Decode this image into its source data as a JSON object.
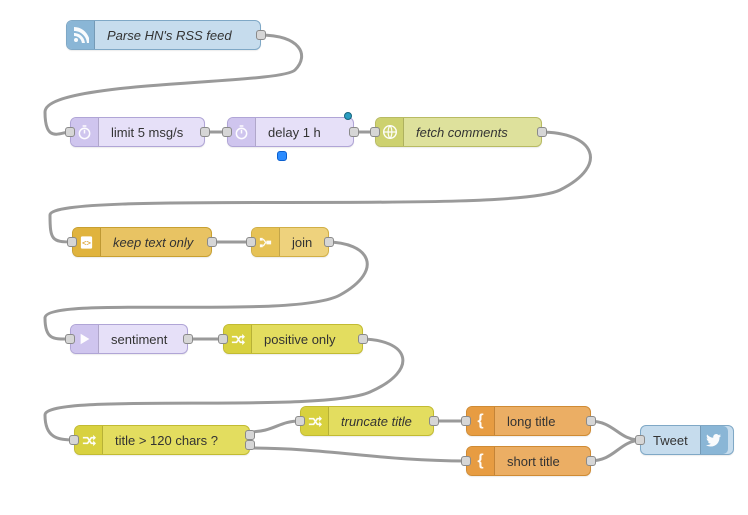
{
  "nodes": {
    "parse_rss": {
      "label": "Parse HN's RSS feed"
    },
    "limit": {
      "label": "limit 5 msg/s"
    },
    "delay": {
      "label": "delay 1 h"
    },
    "fetch": {
      "label": "fetch comments"
    },
    "keep_text": {
      "label": "keep text only"
    },
    "join": {
      "label": "join"
    },
    "sentiment": {
      "label": "sentiment"
    },
    "positive": {
      "label": "positive only"
    },
    "title_check": {
      "label": "title > 120 chars ?"
    },
    "truncate": {
      "label": "truncate title"
    },
    "long_title": {
      "label": "long title"
    },
    "short_title": {
      "label": "short title"
    },
    "tweet": {
      "label": "Tweet"
    }
  },
  "chart_data": {
    "type": "flow-diagram",
    "description": "Node-based flow (Node-RED style) that reads Hacker News RSS, fetches comments, filters by positive sentiment, truncates long titles, and tweets.",
    "nodes": [
      {
        "id": "parse_rss",
        "label": "Parse HN's RSS feed",
        "kind": "rss-in",
        "color": "blue"
      },
      {
        "id": "limit",
        "label": "limit 5 msg/s",
        "kind": "delay/limit",
        "color": "purple"
      },
      {
        "id": "delay",
        "label": "delay 1 h",
        "kind": "delay",
        "color": "purple"
      },
      {
        "id": "fetch",
        "label": "fetch comments",
        "kind": "http-request",
        "color": "olive"
      },
      {
        "id": "keep_text",
        "label": "keep text only",
        "kind": "html/extract",
        "color": "gold"
      },
      {
        "id": "join",
        "label": "join",
        "kind": "join",
        "color": "gold"
      },
      {
        "id": "sentiment",
        "label": "sentiment",
        "kind": "sentiment",
        "color": "purple"
      },
      {
        "id": "positive",
        "label": "positive only",
        "kind": "switch",
        "color": "yellow"
      },
      {
        "id": "title_check",
        "label": "title > 120 chars ?",
        "kind": "switch",
        "color": "yellow"
      },
      {
        "id": "truncate",
        "label": "truncate title",
        "kind": "switch/change",
        "color": "yellow"
      },
      {
        "id": "long_title",
        "label": "long title",
        "kind": "template",
        "color": "orange"
      },
      {
        "id": "short_title",
        "label": "short title",
        "kind": "template",
        "color": "orange"
      },
      {
        "id": "tweet",
        "label": "Tweet",
        "kind": "twitter-out",
        "color": "blue"
      }
    ],
    "edges": [
      [
        "parse_rss",
        "limit"
      ],
      [
        "limit",
        "delay"
      ],
      [
        "delay",
        "fetch"
      ],
      [
        "fetch",
        "keep_text"
      ],
      [
        "keep_text",
        "join"
      ],
      [
        "join",
        "sentiment"
      ],
      [
        "sentiment",
        "positive"
      ],
      [
        "positive",
        "title_check"
      ],
      [
        "title_check",
        "truncate"
      ],
      [
        "title_check",
        "short_title"
      ],
      [
        "truncate",
        "long_title"
      ],
      [
        "long_title",
        "tweet"
      ],
      [
        "short_title",
        "tweet"
      ]
    ]
  }
}
